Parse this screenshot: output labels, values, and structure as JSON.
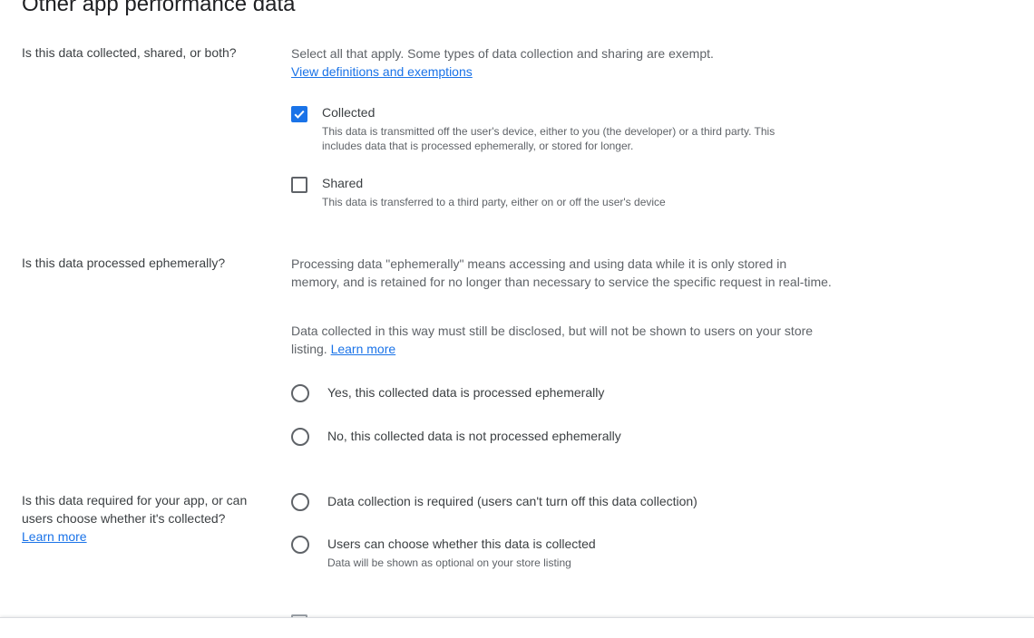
{
  "page": {
    "title": "Other app performance data"
  },
  "section_collected_shared": {
    "question": "Is this data collected, shared, or both?",
    "intro": "Select all that apply. Some types of data collection and sharing are exempt.",
    "link": "View definitions and exemptions",
    "options": [
      {
        "label": "Collected",
        "checked": true,
        "description": "This data is transmitted off the user's device, either to you (the developer) or a third party. This includes data that is processed ephemerally, or stored for longer."
      },
      {
        "label": "Shared",
        "checked": false,
        "description": "This data is transferred to a third party, either on or off the user's device"
      }
    ]
  },
  "section_ephemeral": {
    "question": "Is this data processed ephemerally?",
    "para1": "Processing data \"ephemerally\" means accessing and using data while it is only stored in memory, and is retained for no longer than necessary to service the specific request in real-time.",
    "para2": "Data collected in this way must still be disclosed, but will not be shown to users on your store listing.",
    "para2_link": "Learn more",
    "options": [
      {
        "label": "Yes, this collected data is processed ephemerally",
        "selected": false
      },
      {
        "label": "No, this collected data is not processed ephemerally",
        "selected": false
      }
    ]
  },
  "section_required": {
    "question": "Is this data required for your app, or can users choose whether it's collected?",
    "link": "Learn more",
    "options": [
      {
        "label": "Data collection is required (users can't turn off this data collection)",
        "selected": false,
        "description": ""
      },
      {
        "label": "Users can choose whether this data is collected",
        "selected": false,
        "description": "Data will be shown as optional on your store listing"
      }
    ]
  },
  "colors": {
    "accent": "#1a73e8",
    "text_primary": "#202124",
    "text_secondary": "#5f6368",
    "control_border": "#5f6368"
  }
}
